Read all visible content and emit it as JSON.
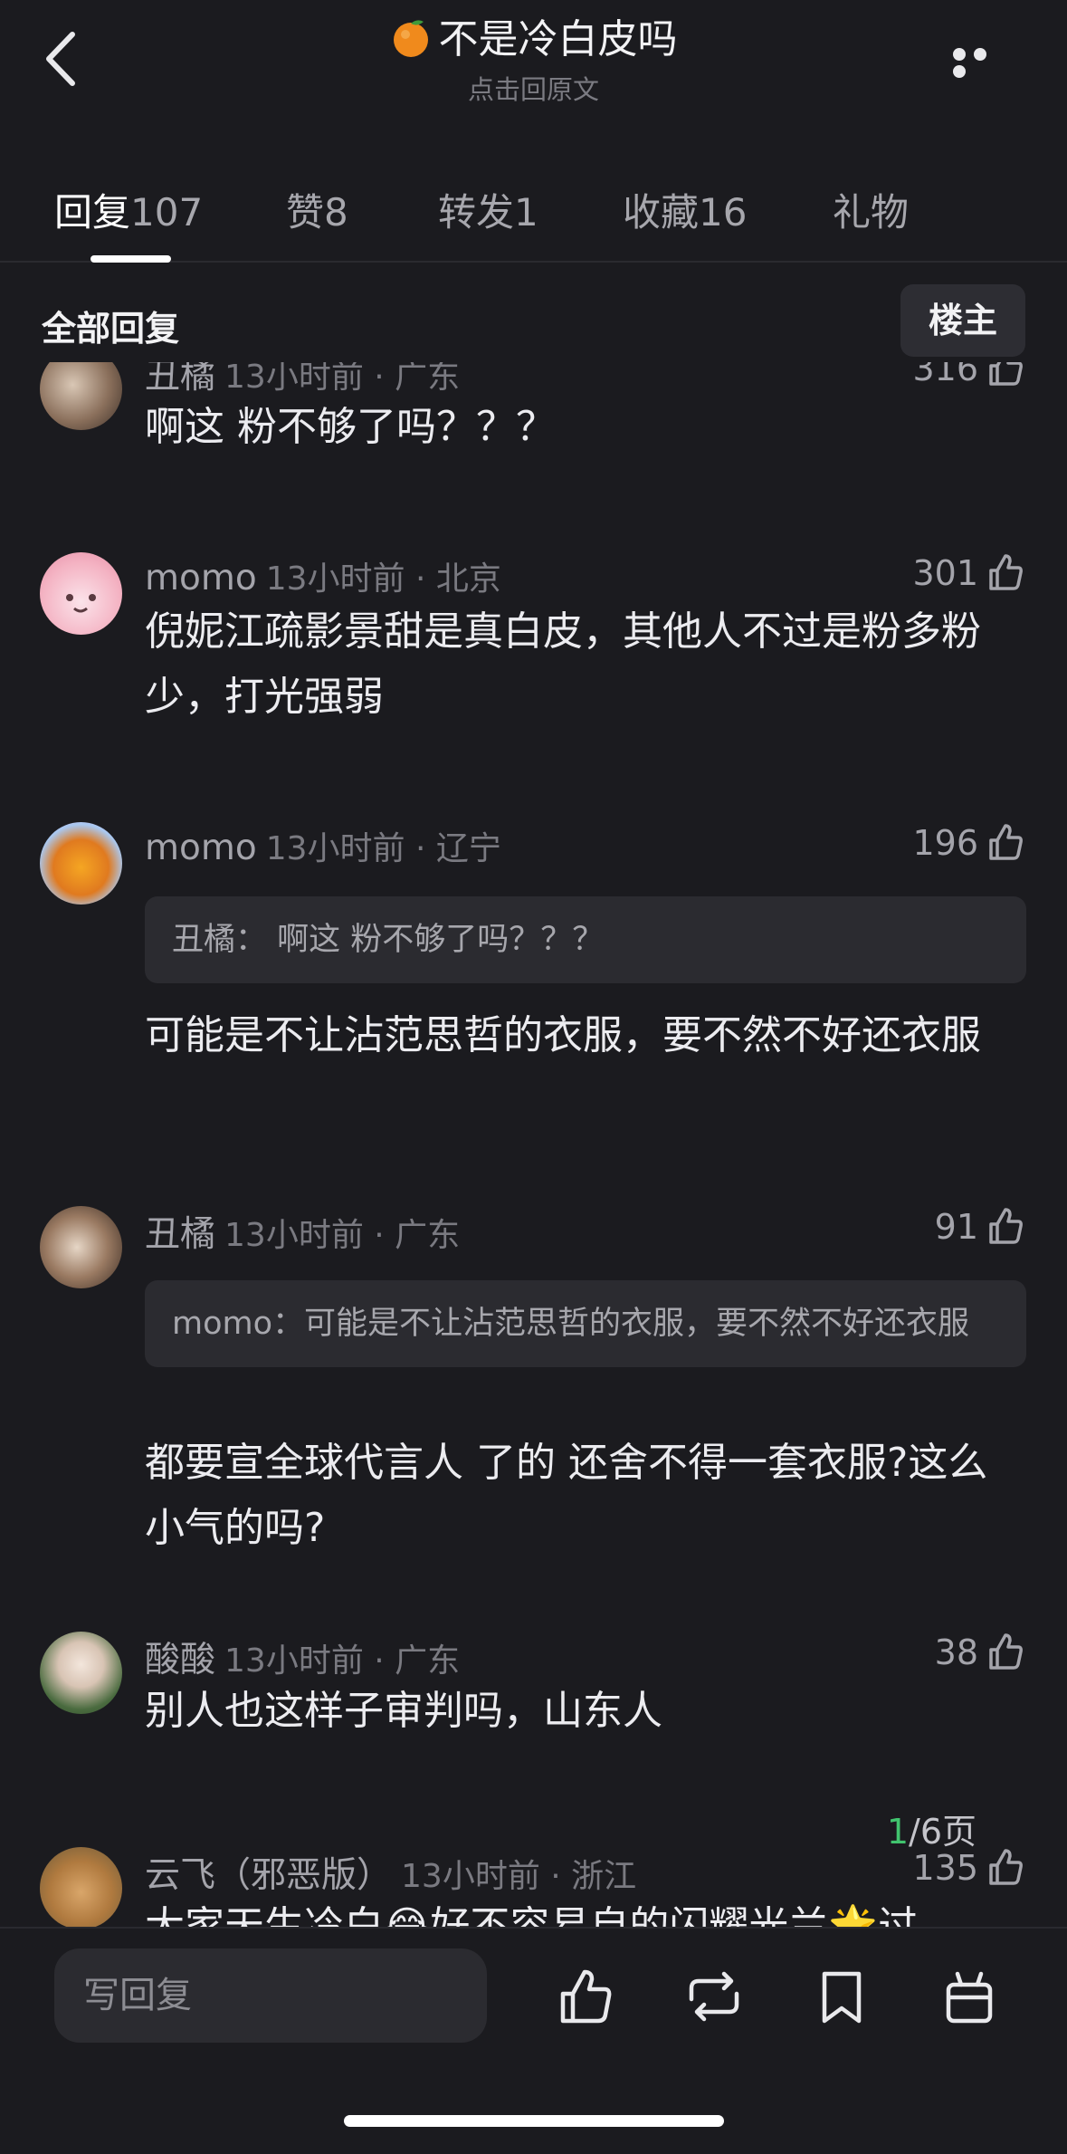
{
  "header": {
    "title": "不是冷白皮吗",
    "subtitle": "点击回原文"
  },
  "tabs": [
    {
      "label": "回复",
      "count": "107"
    },
    {
      "label": "赞",
      "count": "8"
    },
    {
      "label": "转发",
      "count": "1"
    },
    {
      "label": "收藏",
      "count": "16"
    },
    {
      "label": "礼物",
      "count": ""
    }
  ],
  "filter": {
    "label": "全部回复",
    "op_button": "楼主"
  },
  "comments": [
    {
      "name": "丑橘",
      "time": "13小时前 · 广东",
      "likes": "316",
      "text": "啊这  粉不够了吗？？？",
      "quote": ""
    },
    {
      "name": "momo",
      "time": "13小时前 · 北京",
      "likes": "301",
      "text": "倪妮江疏影景甜是真白皮，其他人不过是粉多粉少，打光强弱",
      "quote": ""
    },
    {
      "name": "momo",
      "time": "13小时前 · 辽宁",
      "likes": "196",
      "text": "可能是不让沾范思哲的衣服，要不然不好还衣服",
      "quote": "丑橘：  啊这  粉不够了吗？？？"
    },
    {
      "name": "丑橘",
      "time": "13小时前 · 广东",
      "likes": "91",
      "text": "都要宣全球代言人 了的 还舍不得一套衣服?这么小气的吗?",
      "quote": "momo：可能是不让沾范思哲的衣服，要不然不好还衣服"
    },
    {
      "name": "酸酸",
      "time": "13小时前 · 广东",
      "likes": "38",
      "text": "别人也这样子审判吗，山东人",
      "quote": ""
    },
    {
      "name": "云飞（邪恶版）",
      "time": "13小时前 · 浙江",
      "likes": "135",
      "text": "大家天生冷白😂好不容易自的闪耀光兰🌟过",
      "quote": ""
    }
  ],
  "pager": {
    "current": "1",
    "total_text": "/6页"
  },
  "bottombar": {
    "reply_placeholder": "写回复",
    "icons": [
      "thumbs-up-icon",
      "repost-icon",
      "bookmark-icon",
      "gift-icon"
    ]
  },
  "colors": {
    "background": "#1b1b1f",
    "accent_green": "#41c46e"
  }
}
